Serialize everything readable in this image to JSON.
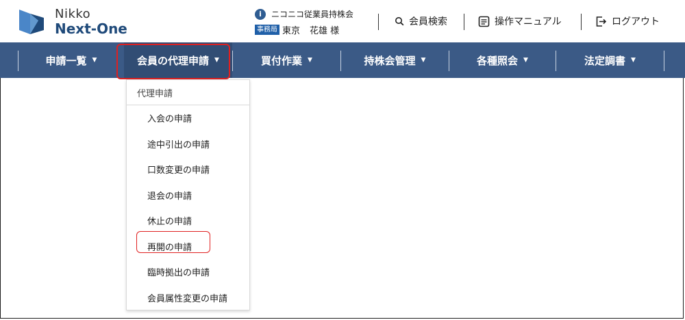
{
  "brand": {
    "line1": "Nikko",
    "line2": "Next-One"
  },
  "user": {
    "info_icon": "info-icon",
    "association": "ニコニコ従業員持株会",
    "role_badge": "事務局",
    "location": "東京",
    "name": "花雄 様"
  },
  "header_links": [
    {
      "label": "会員検索",
      "icon": "search-icon"
    },
    {
      "label": "操作マニュアル",
      "icon": "manual-icon"
    },
    {
      "label": "ログアウト",
      "icon": "logout-icon"
    }
  ],
  "nav": [
    {
      "label": "申請一覧"
    },
    {
      "label": "会員の代理申請"
    },
    {
      "label": "買付作業"
    },
    {
      "label": "持株会管理"
    },
    {
      "label": "各種照会"
    },
    {
      "label": "法定調書"
    }
  ],
  "dropdown": {
    "header": "代理申請",
    "items": [
      "入会の申請",
      "途中引出の申請",
      "口数変更の申請",
      "退会の申請",
      "休止の申請",
      "再開の申請",
      "臨時拠出の申請",
      "会員属性変更の申請"
    ]
  },
  "colors": {
    "navbar": "#3b5a86",
    "brand_text": "#1f4a7a",
    "highlight": "#e02020",
    "badge": "#1f5fa8"
  }
}
